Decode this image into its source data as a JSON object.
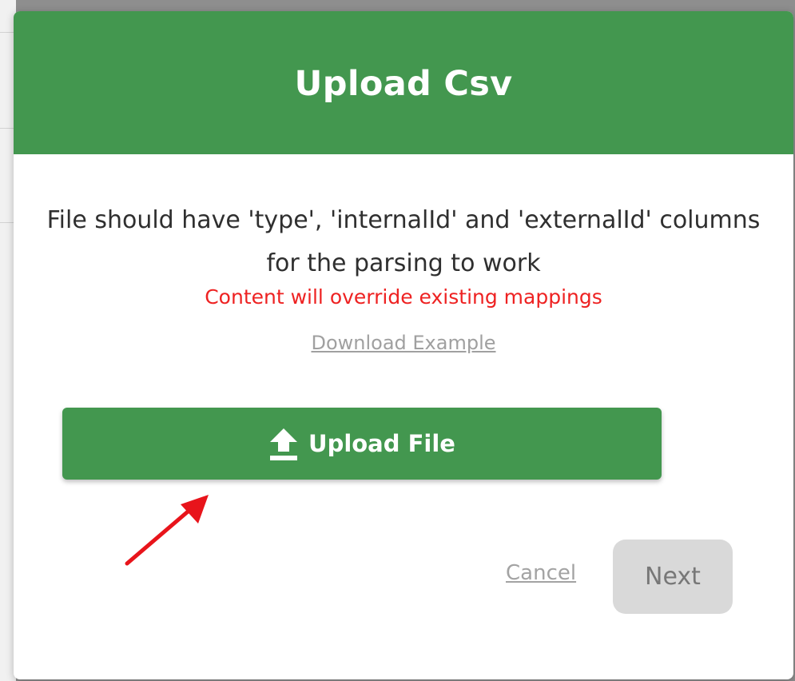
{
  "modal": {
    "title": "Upload Csv",
    "description": "File should have 'type', 'internalId' and 'externalId' columns for the parsing to work",
    "warning": "Content will override existing mappings",
    "download_link": "Download Example",
    "upload_button": {
      "label": "Upload File",
      "icon": "upload-icon"
    },
    "cancel_label": "Cancel",
    "next_label": "Next"
  },
  "colors": {
    "header_green": "#43974f",
    "warning_red": "#ee2222",
    "link_gray": "#a0a0a0",
    "disabled_button_bg": "#d9d9d9",
    "annotation_arrow": "#e8141b"
  }
}
